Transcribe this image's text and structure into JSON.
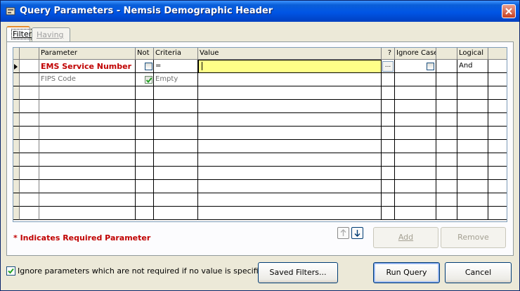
{
  "window": {
    "title": "Query Parameters - Nemsis Demographic Header"
  },
  "tabs": {
    "filter": "Filter",
    "having": "Having"
  },
  "grid": {
    "headers": [
      "Parameter",
      "Not",
      "Criteria",
      "Value",
      "?",
      "Ignore Case",
      "",
      "Logical"
    ],
    "rows": [
      {
        "parameter": "EMS Service Number",
        "not": false,
        "criteria": "=",
        "value": "",
        "ignore_case": false,
        "logical": "And",
        "required": true
      },
      {
        "parameter": "FIPS Code",
        "not": true,
        "criteria": "Empty",
        "value": "",
        "ignore_case": null,
        "logical": "",
        "required": false
      }
    ],
    "ellipsis": "..."
  },
  "required_note": "* Indicates Required Parameter",
  "buttons": {
    "add": "Add",
    "remove": "Remove",
    "saved_filters": "Saved Filters...",
    "run_query": "Run Query",
    "cancel": "Cancel"
  },
  "ignore_checkbox": {
    "label": "Ignore parameters which are not required if no value is specified.",
    "checked": true
  },
  "colors": {
    "title_bar": "#0055e5",
    "required": "#c00000",
    "highlight": "#ffff88"
  }
}
